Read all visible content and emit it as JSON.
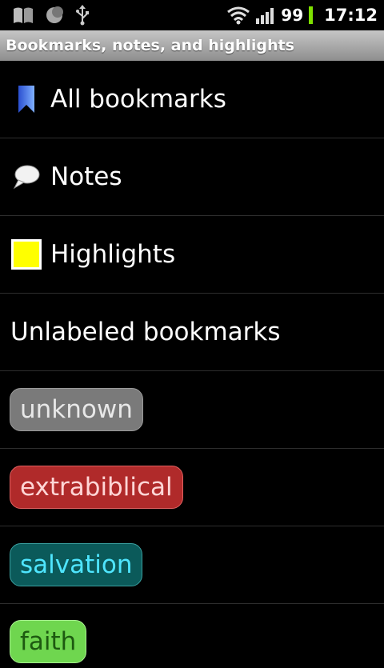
{
  "status_bar": {
    "battery_level": "99",
    "battery_color": "#7ee000",
    "time": "17:12",
    "icons_left": [
      "book-icon",
      "moon-icon",
      "usb-icon"
    ],
    "icons_right": [
      "wifi-icon",
      "signal-icon",
      "battery-icon"
    ]
  },
  "title_bar": {
    "title": "Bookmarks, notes, and highlights"
  },
  "list": {
    "items": [
      {
        "label": "All bookmarks",
        "icon": "bookmark-icon"
      },
      {
        "label": "Notes",
        "icon": "speech-bubble-icon"
      },
      {
        "label": "Highlights",
        "icon": "highlight-swatch-icon",
        "swatch_color": "#ffff00"
      },
      {
        "label": "Unlabeled bookmarks"
      }
    ],
    "labels": [
      {
        "label": "unknown",
        "color": "#7a7a7a"
      },
      {
        "label": "extrabiblical",
        "color": "#b02a2a"
      },
      {
        "label": "salvation",
        "color": "#0b5a5a"
      },
      {
        "label": "faith",
        "color": "#6fd64f"
      }
    ]
  }
}
